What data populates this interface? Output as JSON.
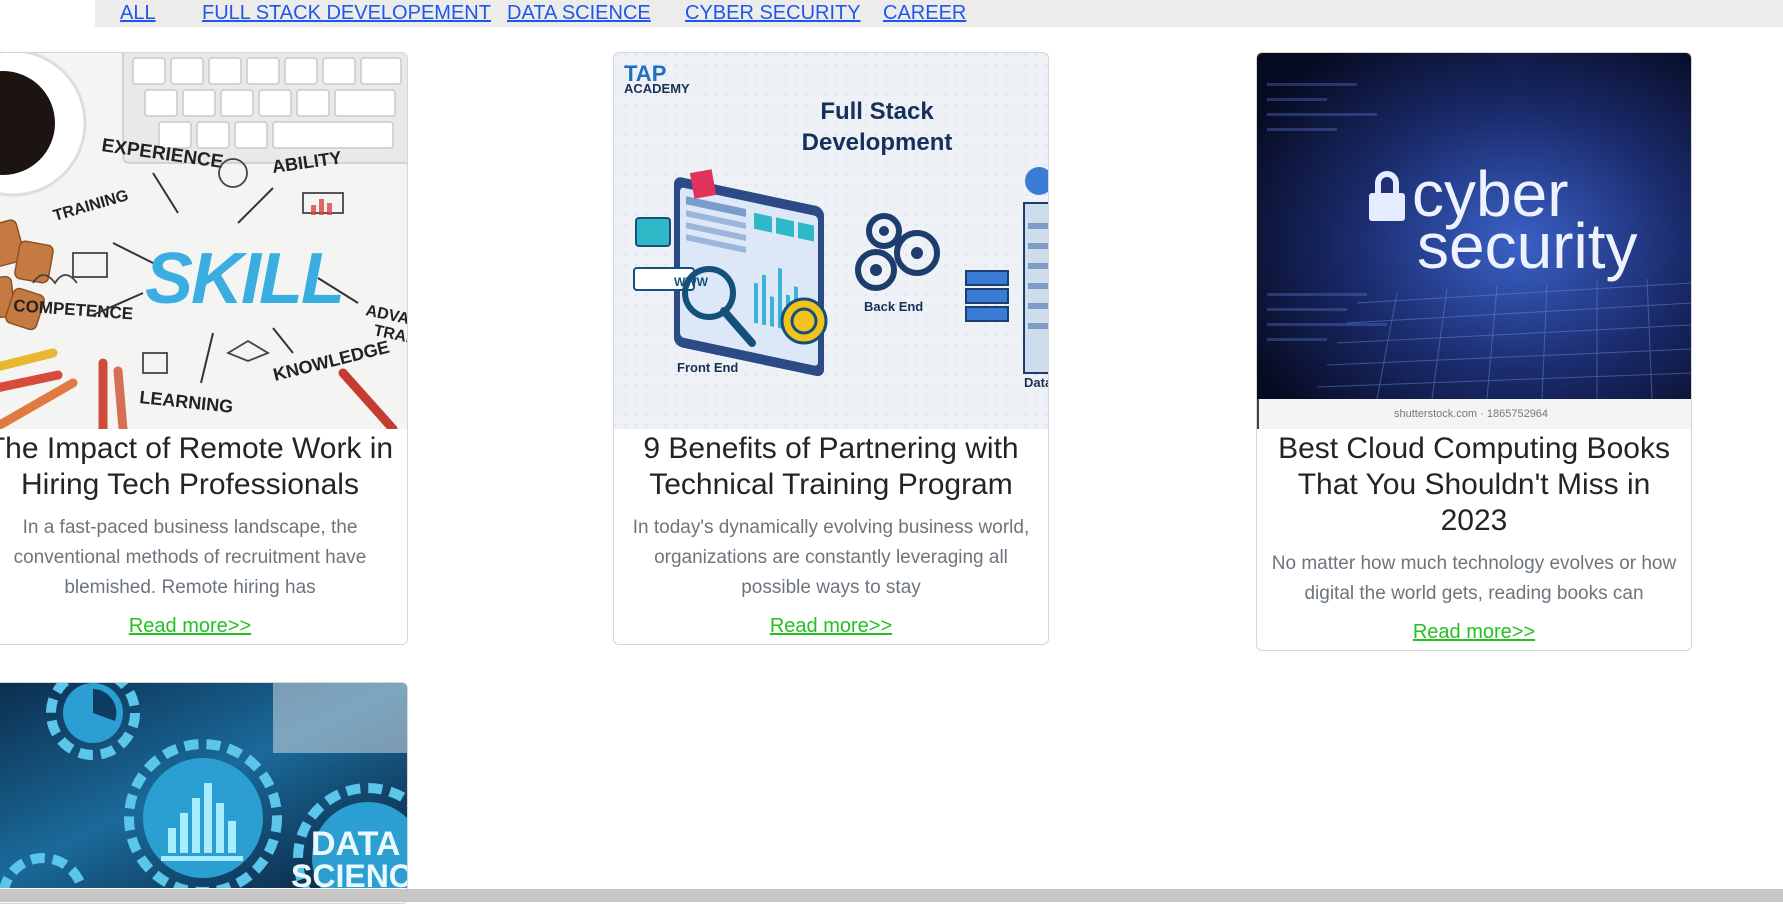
{
  "filters": {
    "items": [
      {
        "label": "ALL"
      },
      {
        "label": "FULL STACK DEVELOPEMENT"
      },
      {
        "label": "DATA SCIENCE"
      },
      {
        "label": "CYBER SECURITY"
      },
      {
        "label": "CAREER"
      }
    ]
  },
  "cards": [
    {
      "title": "The Impact of Remote Work in Hiring Tech Professionals",
      "title_line1": "The Impact of Remote Work in",
      "title_line2": "Hiring Tech Professionals",
      "excerpt": "In a fast-paced business landscape, the conventional methods of recruitment have blemished. Remote hiring has",
      "read_more": "Read more>>",
      "image": {
        "subject": "skill-mindmap",
        "words": [
          "EXPERIENCE",
          "ABILITY",
          "TRAINING",
          "SKILL",
          "COMPETENCE",
          "ADVA",
          "TRAI",
          "KNOWLEDGE",
          "LEARNING"
        ]
      }
    },
    {
      "title_line1": "9 Benefits of Partnering with",
      "title_line2": "Technical Training Program",
      "excerpt": "In today's dynamically evolving business world, organizations are constantly leveraging all possible ways to stay",
      "read_more": "Read more>>",
      "image": {
        "subject": "full-stack-development",
        "brand_line1": "TAP",
        "brand_line2": "ACADEMY",
        "heading_line1": "Full Stack",
        "heading_line2": "Development",
        "label_front": "Front End",
        "label_back": "Back End",
        "label_data": "Data",
        "browser_text": "WWW"
      }
    },
    {
      "title_line1": "Best Cloud Computing Books",
      "title_line2": "That You Shouldn't Miss in",
      "title_line3": "2023",
      "excerpt": "No matter how much technology evolves or how digital the world gets, reading books can",
      "read_more": "Read more>>",
      "image": {
        "subject": "cyber-security",
        "text_line1": "cyber",
        "text_line2": "security",
        "watermark": "shutterstock.com · 1865752964"
      }
    },
    {
      "image": {
        "subject": "data-science",
        "text_line1": "DATA",
        "text_line2": "SCIENCE"
      }
    }
  ],
  "colors": {
    "link_blue": "#2255ee",
    "read_more_green": "#23c023",
    "filter_bar_bg": "#ecedea"
  }
}
